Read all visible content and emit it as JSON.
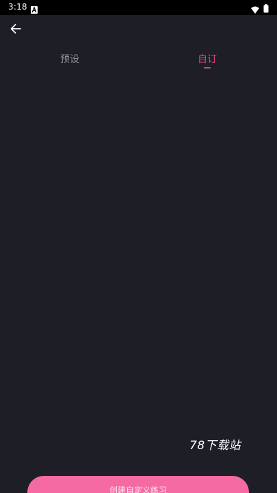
{
  "status_bar": {
    "time": "3:18",
    "app_icon": "a-box-icon",
    "wifi_icon": "wifi-icon",
    "battery_icon": "battery-icon"
  },
  "header": {
    "back_icon": "arrow-left-icon"
  },
  "tabs": [
    {
      "label": "预设",
      "active": false
    },
    {
      "label": "自订",
      "active": true
    }
  ],
  "colors": {
    "background": "#1d1e26",
    "accent": "#e0457b",
    "inactive_tab": "#8e8f96",
    "button": "#f56aa3"
  },
  "watermark": "78下载站",
  "create_button": {
    "label": "创建自定义练习"
  }
}
